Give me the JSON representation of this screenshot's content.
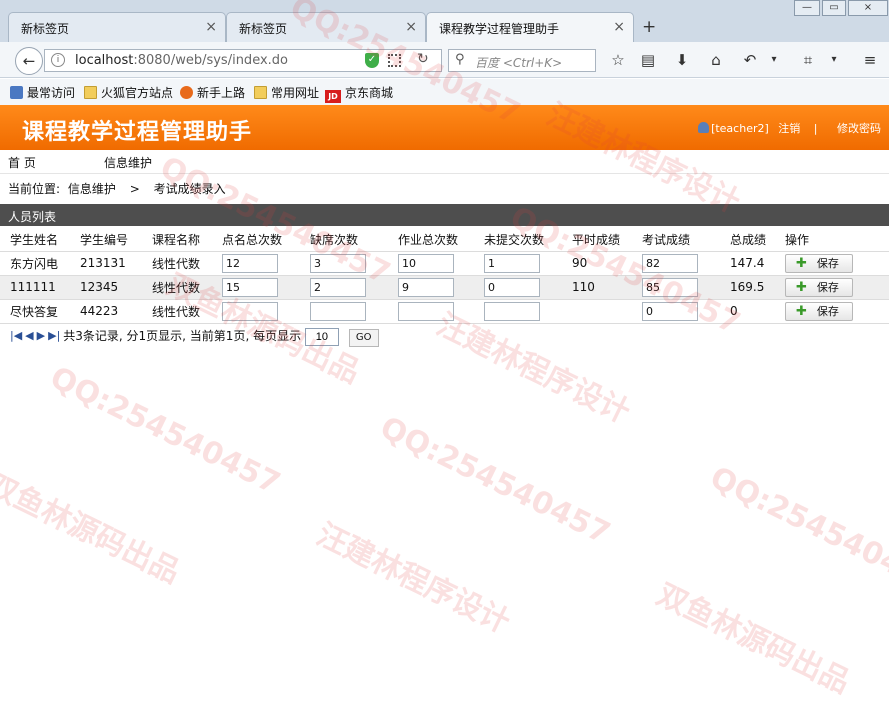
{
  "browser": {
    "tabs": [
      {
        "title": "新标签页"
      },
      {
        "title": "新标签页"
      },
      {
        "title": "课程教学过程管理助手"
      }
    ],
    "url": {
      "host": "localhost",
      "rest": ":8080/web/sys/index.do"
    },
    "search_placeholder": "百度 <Ctrl+K>",
    "bookmarks": [
      {
        "label": "最常访问"
      },
      {
        "label": "火狐官方站点"
      },
      {
        "label": "新手上路"
      },
      {
        "label": "常用网址"
      },
      {
        "label": "京东商城"
      }
    ]
  },
  "app": {
    "title": "课程教学过程管理助手",
    "user": "[teacher2]",
    "logout": "注销",
    "divider": "|",
    "change_password": "修改密码"
  },
  "menu": [
    "首 页",
    "信息维护"
  ],
  "breadcrumb": {
    "prefix": "当前位置:",
    "level1": "信息维护",
    "sep": ">",
    "level2": "考试成绩录入"
  },
  "list_title": "人员列表",
  "table": {
    "headers": [
      "学生姓名",
      "学生编号",
      "课程名称",
      "点名总次数",
      "缺席次数",
      "作业总次数",
      "未提交次数",
      "平时成绩",
      "考试成绩",
      "总成绩",
      "操作"
    ],
    "save_label": "保存",
    "rows": [
      {
        "name": "东方闪电",
        "id": "213131",
        "course": "线性代数",
        "roll": "12",
        "absent": "3",
        "hw_total": "10",
        "unsubmitted": "1",
        "usual": "90",
        "exam": "82",
        "total": "147.4"
      },
      {
        "name": "111111",
        "id": "12345",
        "course": "线性代数",
        "roll": "15",
        "absent": "2",
        "hw_total": "9",
        "unsubmitted": "0",
        "usual": "110",
        "exam": "85",
        "total": "169.5"
      },
      {
        "name": "尽快答复",
        "id": "44223",
        "course": "线性代数",
        "roll": "",
        "absent": "",
        "hw_total": "",
        "unsubmitted": "",
        "usual": "",
        "exam": "0",
        "total": "0"
      }
    ]
  },
  "pager": {
    "summary": "共3条记录, 分1页显示, 当前第1页, 每页显示",
    "page_size": "10",
    "go": "GO"
  },
  "watermark": {
    "qq": "QQ:254540457",
    "line1": "双鱼林源码出品",
    "line2": "汪建林程序设计"
  }
}
